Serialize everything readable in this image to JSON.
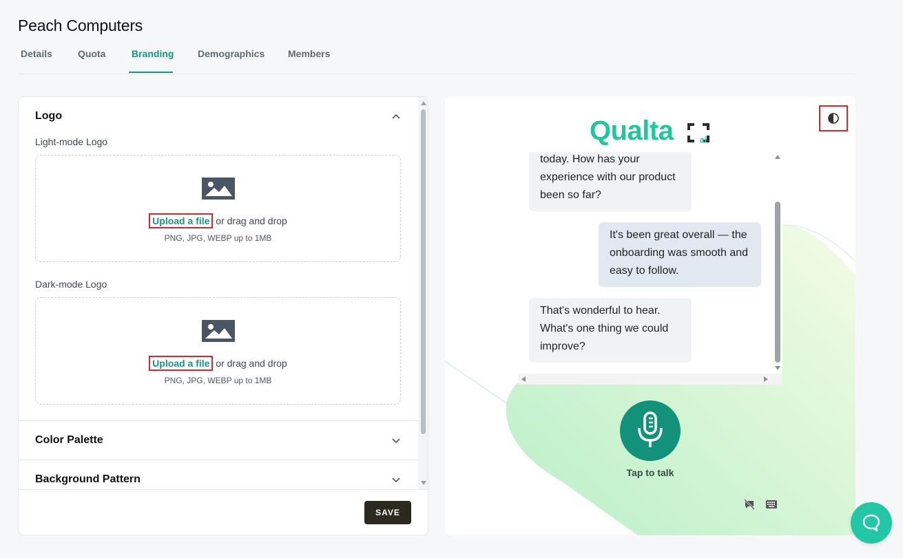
{
  "page": {
    "title": "Peach Computers"
  },
  "tabs": [
    {
      "label": "Details",
      "active": false
    },
    {
      "label": "Quota",
      "active": false
    },
    {
      "label": "Branding",
      "active": true
    },
    {
      "label": "Demographics",
      "active": false
    },
    {
      "label": "Members",
      "active": false
    }
  ],
  "accent_color": "#17957e",
  "branding": {
    "logo_section": {
      "title": "Logo",
      "expanded": true,
      "light_label": "Light-mode Logo",
      "dark_label": "Dark-mode Logo",
      "upload_link": "Upload a file",
      "upload_suffix": "or drag and drop",
      "hint": "PNG, JPG, WEBP up to 1MB"
    },
    "color_palette": {
      "title": "Color Palette",
      "expanded": false
    },
    "background_pattern": {
      "title": "Background Pattern",
      "expanded": false
    },
    "save_label": "SAVE"
  },
  "preview": {
    "logo_text": "Qualta",
    "logo_suffix": "ai",
    "messages": [
      {
        "from": "bot",
        "lines": [
          "today. How has your",
          "experience with our product",
          "been so far?"
        ]
      },
      {
        "from": "user",
        "lines": [
          "It's been great overall — the",
          "onboarding was smooth and",
          "easy to follow."
        ]
      },
      {
        "from": "bot",
        "lines": [
          "That's wonderful to hear.",
          "What's one thing we could",
          "improve?"
        ]
      }
    ],
    "tap_label": "Tap to talk",
    "icons": [
      "contrast-toggle-icon",
      "microphone-icon",
      "comment-off-icon",
      "keyboard-icon",
      "help-chat-icon"
    ]
  }
}
